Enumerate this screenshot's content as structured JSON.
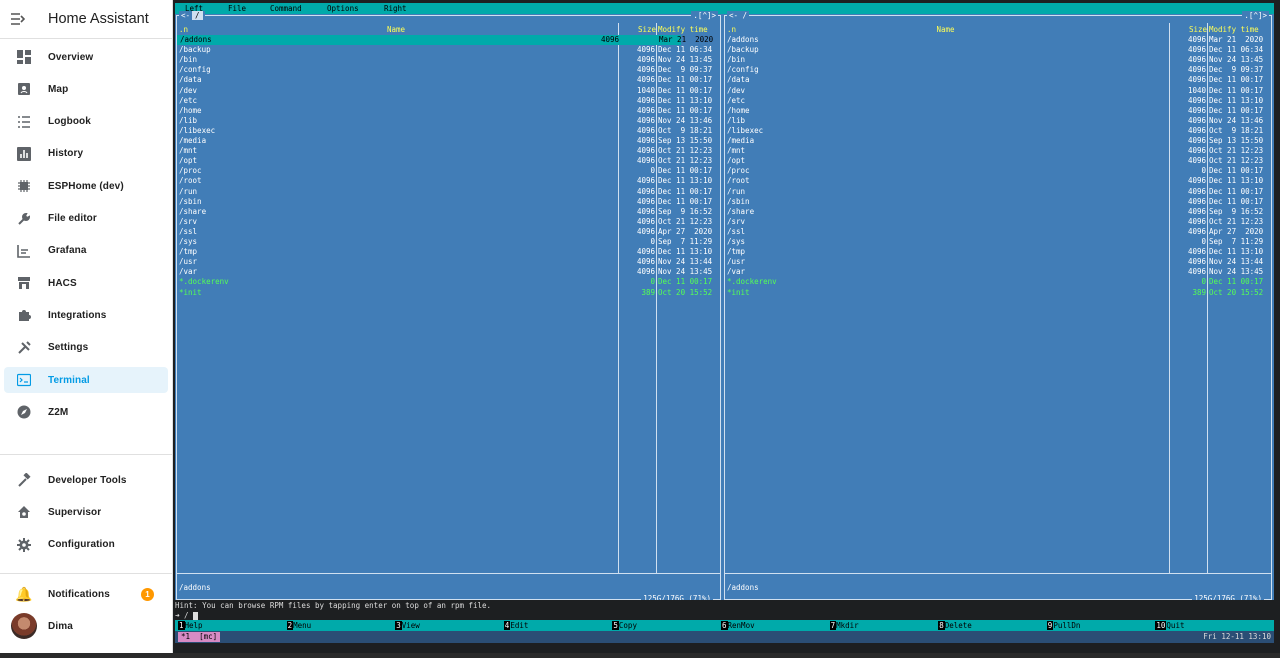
{
  "sidebar": {
    "title": "Home Assistant",
    "items": [
      {
        "label": "Overview",
        "icon": "dashboard-icon"
      },
      {
        "label": "Map",
        "icon": "map-icon"
      },
      {
        "label": "Logbook",
        "icon": "list-icon"
      },
      {
        "label": "History",
        "icon": "chart-icon"
      },
      {
        "label": "ESPHome (dev)",
        "icon": "chip-icon"
      },
      {
        "label": "File editor",
        "icon": "wrench-icon"
      },
      {
        "label": "Grafana",
        "icon": "graph-icon"
      },
      {
        "label": "HACS",
        "icon": "store-icon"
      },
      {
        "label": "Integrations",
        "icon": "puzzle-icon"
      },
      {
        "label": "Settings",
        "icon": "tools-icon"
      },
      {
        "label": "Terminal",
        "icon": "terminal-icon",
        "active": true
      },
      {
        "label": "Z2M",
        "icon": "compass-icon"
      }
    ],
    "tools": [
      {
        "label": "Developer Tools",
        "icon": "hammer-icon"
      },
      {
        "label": "Supervisor",
        "icon": "home-gear-icon"
      },
      {
        "label": "Configuration",
        "icon": "gear-icon"
      }
    ],
    "notifications": {
      "label": "Notifications",
      "count": "1"
    },
    "user": {
      "label": "Dima"
    }
  },
  "terminal": {
    "menu": [
      "Left",
      "File",
      "Command",
      "Options",
      "Right"
    ],
    "panel_path": "/",
    "panel_prefix_left": "<-",
    "panel_prefix_right": "<- /",
    "panel_flags": ".[^]>",
    "headers": {
      "n": ".n",
      "name": "Name",
      "size": "Size",
      "time": "Modify time"
    },
    "files": [
      {
        "name": "/addons",
        "size": "4096",
        "time": "Mar 21  2020"
      },
      {
        "name": "/backup",
        "size": "4096",
        "time": "Dec 11 06:34"
      },
      {
        "name": "/bin",
        "size": "4096",
        "time": "Nov 24 13:45"
      },
      {
        "name": "/config",
        "size": "4096",
        "time": "Dec  9 09:37"
      },
      {
        "name": "/data",
        "size": "4096",
        "time": "Dec 11 00:17"
      },
      {
        "name": "/dev",
        "size": "1040",
        "time": "Dec 11 00:17"
      },
      {
        "name": "/etc",
        "size": "4096",
        "time": "Dec 11 13:10"
      },
      {
        "name": "/home",
        "size": "4096",
        "time": "Dec 11 00:17"
      },
      {
        "name": "/lib",
        "size": "4096",
        "time": "Nov 24 13:46"
      },
      {
        "name": "/libexec",
        "size": "4096",
        "time": "Oct  9 18:21"
      },
      {
        "name": "/media",
        "size": "4096",
        "time": "Sep 13 15:50"
      },
      {
        "name": "/mnt",
        "size": "4096",
        "time": "Oct 21 12:23"
      },
      {
        "name": "/opt",
        "size": "4096",
        "time": "Oct 21 12:23"
      },
      {
        "name": "/proc",
        "size": "0",
        "time": "Dec 11 00:17"
      },
      {
        "name": "/root",
        "size": "4096",
        "time": "Dec 11 13:10"
      },
      {
        "name": "/run",
        "size": "4096",
        "time": "Dec 11 00:17"
      },
      {
        "name": "/sbin",
        "size": "4096",
        "time": "Dec 11 00:17"
      },
      {
        "name": "/share",
        "size": "4096",
        "time": "Sep  9 16:52"
      },
      {
        "name": "/srv",
        "size": "4096",
        "time": "Oct 21 12:23"
      },
      {
        "name": "/ssl",
        "size": "4096",
        "time": "Apr 27  2020"
      },
      {
        "name": "/sys",
        "size": "0",
        "time": "Sep  7 11:29"
      },
      {
        "name": "/tmp",
        "size": "4096",
        "time": "Dec 11 13:10"
      },
      {
        "name": "/usr",
        "size": "4096",
        "time": "Nov 24 13:44"
      },
      {
        "name": "/var",
        "size": "4096",
        "time": "Nov 24 13:45"
      },
      {
        "name": "*.dockerenv",
        "size": "0",
        "time": "Dec 11 00:17",
        "exec": true
      },
      {
        "name": "*init",
        "size": "389",
        "time": "Oct 20 15:52",
        "exec": true
      }
    ],
    "footer_path": "/addons",
    "disk": "125G/176G (71%)",
    "hint": "Hint: You can browse RPM files by tapping enter on top of an rpm file.",
    "prompt": "➜ /",
    "fkeys": [
      {
        "num": "1",
        "label": "Help"
      },
      {
        "num": "2",
        "label": "Menu"
      },
      {
        "num": "3",
        "label": "View"
      },
      {
        "num": "4",
        "label": "Edit"
      },
      {
        "num": "5",
        "label": "Copy"
      },
      {
        "num": "6",
        "label": "RenMov"
      },
      {
        "num": "7",
        "label": "Mkdir"
      },
      {
        "num": "8",
        "label": "Delete"
      },
      {
        "num": "9",
        "label": "PullDn"
      },
      {
        "num": "10",
        "label": "Quit"
      }
    ],
    "status": {
      "tab": "*1",
      "session": "[mc]",
      "clock": "Fri 12-11 13:10"
    }
  },
  "colors": {
    "panel_bg": "#417db7",
    "accent_cyan": "#00aaaa",
    "active_blue": "#039be5",
    "header_yellow": "#ffff55",
    "exec_green": "#55ff55",
    "badge": "#ff9800"
  }
}
